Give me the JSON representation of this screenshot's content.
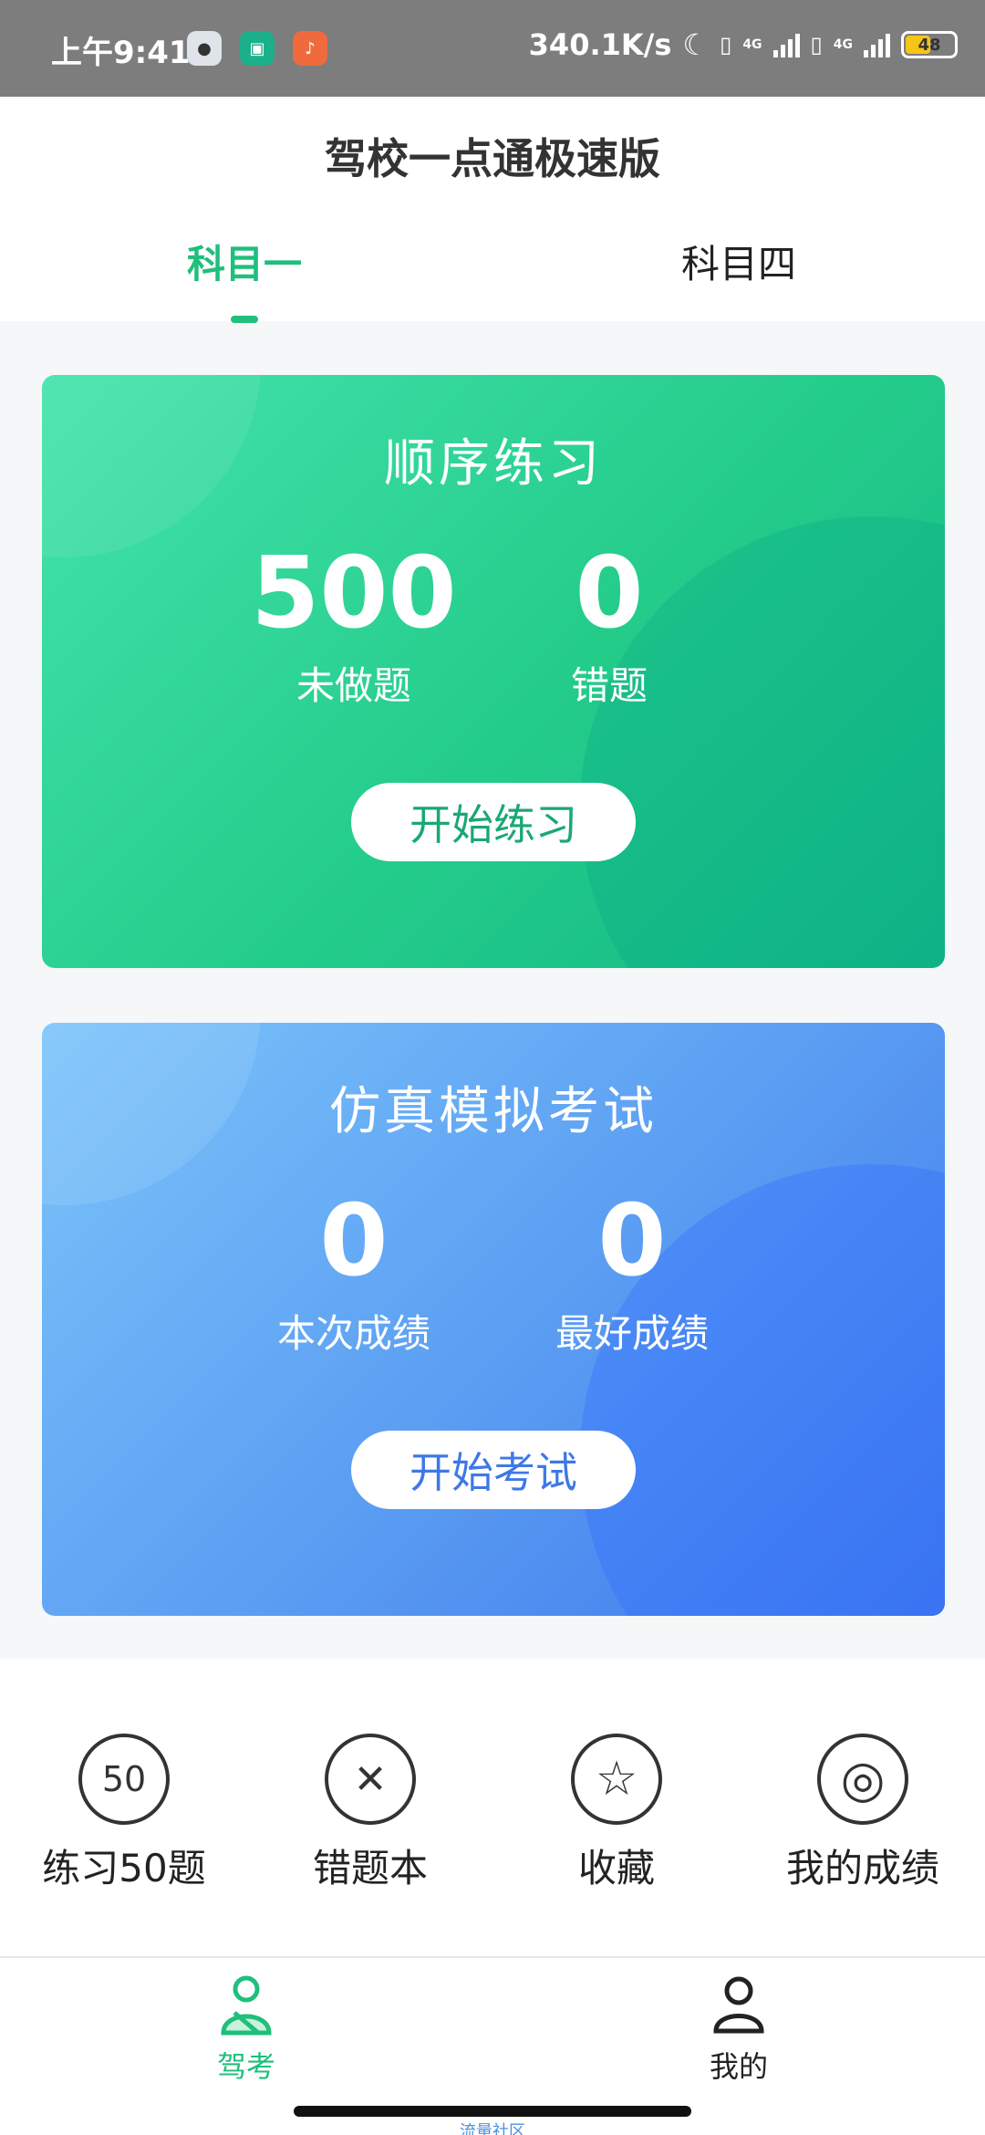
{
  "status_bar": {
    "time": "上午9:41",
    "network_speed": "340.1K/s",
    "network_type": "4G",
    "battery": "48",
    "app_icons": [
      "qq-penguin-icon",
      "android-store-icon",
      "microphone-app-icon"
    ]
  },
  "header": {
    "title": "驾校一点通极速版",
    "tabs": [
      {
        "label": "科目一",
        "active": true
      },
      {
        "label": "科目四",
        "active": false
      }
    ]
  },
  "practice_card": {
    "title": "顺序练习",
    "stats": [
      {
        "value": "500",
        "label": "未做题"
      },
      {
        "value": "0",
        "label": "错题"
      }
    ],
    "button": "开始练习",
    "color": "#24cc8a"
  },
  "exam_card": {
    "title": "仿真模拟考试",
    "stats": [
      {
        "value": "0",
        "label": "本次成绩"
      },
      {
        "value": "0",
        "label": "最好成绩"
      }
    ],
    "button": "开始考试",
    "color": "#4a86ef"
  },
  "quick_actions": [
    {
      "label": "练习50题",
      "icon": "fifty-questions-icon",
      "glyph": "50"
    },
    {
      "label": "错题本",
      "icon": "wrong-answers-icon",
      "glyph": "✕"
    },
    {
      "label": "收藏",
      "icon": "star-icon",
      "glyph": "☆"
    },
    {
      "label": "我的成绩",
      "icon": "score-icon",
      "glyph": "◎"
    }
  ],
  "bottom_nav": [
    {
      "label": "驾考",
      "icon": "driving-test-icon",
      "active": true
    },
    {
      "label": "我的",
      "icon": "profile-icon",
      "active": false
    }
  ],
  "footer_note": "流量社区",
  "colors": {
    "accent_green": "#1fbf7c",
    "accent_blue": "#3f78e6"
  }
}
